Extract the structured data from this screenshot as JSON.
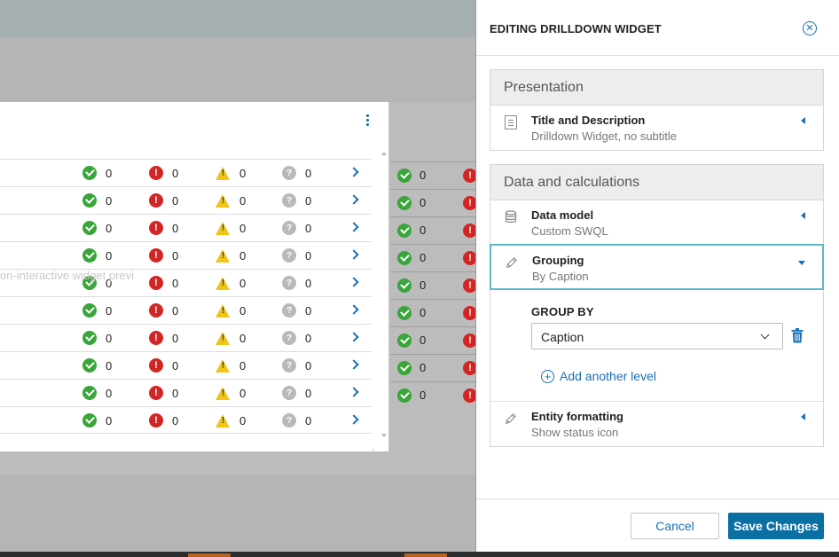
{
  "preview": {
    "watermark": "on-interactive widget previ",
    "rows": [
      {
        "ok": "0",
        "critical": "0",
        "warning": "0",
        "unknown": "0"
      },
      {
        "ok": "0",
        "critical": "0",
        "warning": "0",
        "unknown": "0"
      },
      {
        "ok": "0",
        "critical": "0",
        "warning": "0",
        "unknown": "0"
      },
      {
        "ok": "0",
        "critical": "0",
        "warning": "0",
        "unknown": "0"
      },
      {
        "ok": "0",
        "critical": "0",
        "warning": "0",
        "unknown": "0"
      },
      {
        "ok": "0",
        "critical": "0",
        "warning": "0",
        "unknown": "0"
      },
      {
        "ok": "0",
        "critical": "0",
        "warning": "0",
        "unknown": "0"
      },
      {
        "ok": "0",
        "critical": "0",
        "warning": "0",
        "unknown": "0"
      },
      {
        "ok": "0",
        "critical": "0",
        "warning": "0",
        "unknown": "0"
      },
      {
        "ok": "0",
        "critical": "0",
        "warning": "0",
        "unknown": "0"
      }
    ],
    "behind_rows": [
      "0",
      "0",
      "0",
      "0",
      "0",
      "0",
      "0",
      "0",
      "0"
    ]
  },
  "panel": {
    "title": "EDITING DRILLDOWN WIDGET",
    "close_glyph": "✕",
    "presentation": {
      "heading": "Presentation",
      "items": [
        {
          "title": "Title and Description",
          "subtitle": "Drilldown Widget, no subtitle",
          "icon": "document-icon"
        }
      ]
    },
    "data_calc": {
      "heading": "Data and calculations",
      "data_model": {
        "title": "Data model",
        "subtitle": "Custom SWQL",
        "icon": "database-icon"
      },
      "grouping": {
        "title": "Grouping",
        "subtitle": "By Caption",
        "icon": "pencil-icon",
        "expanded": true
      },
      "group_by": {
        "label": "GROUP BY",
        "selected": "Caption",
        "add_label": "Add another level",
        "add_glyph": "+"
      },
      "entity_formatting": {
        "title": "Entity formatting",
        "subtitle": "Show status icon",
        "icon": "pencil-icon"
      }
    },
    "footer": {
      "cancel": "Cancel",
      "save": "Save Changes"
    }
  },
  "colors": {
    "accent": "#0a6fa3",
    "link": "#1a6fb5",
    "ok": "#3aa53a",
    "critical": "#d42525",
    "warning": "#f0c419",
    "unknown": "#b9b9b9",
    "active_border": "#5bb8c8"
  }
}
